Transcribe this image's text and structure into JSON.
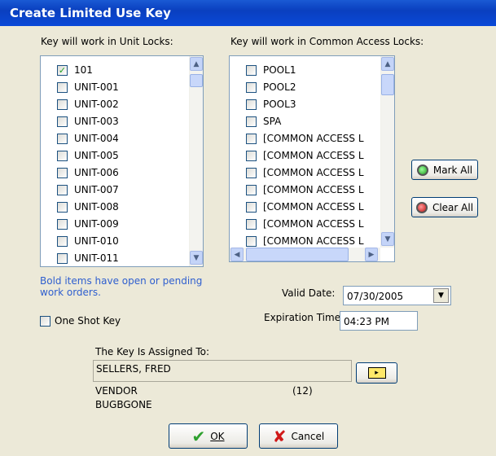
{
  "window": {
    "title": "Create Limited Use Key"
  },
  "unit_locks": {
    "label": "Key will work in Unit Locks:",
    "items": [
      {
        "label": "101",
        "checked": true
      },
      {
        "label": "UNIT-001",
        "checked": false
      },
      {
        "label": "UNIT-002",
        "checked": false
      },
      {
        "label": "UNIT-003",
        "checked": false
      },
      {
        "label": "UNIT-004",
        "checked": false
      },
      {
        "label": "UNIT-005",
        "checked": false
      },
      {
        "label": "UNIT-006",
        "checked": false
      },
      {
        "label": "UNIT-007",
        "checked": false
      },
      {
        "label": "UNIT-008",
        "checked": false
      },
      {
        "label": "UNIT-009",
        "checked": false
      },
      {
        "label": "UNIT-010",
        "checked": false
      },
      {
        "label": "UNIT-011",
        "checked": false
      }
    ]
  },
  "common_locks": {
    "label": "Key will work in Common Access Locks:",
    "items": [
      {
        "label": "POOL1",
        "checked": false
      },
      {
        "label": "POOL2",
        "checked": false
      },
      {
        "label": "POOL3",
        "checked": false
      },
      {
        "label": "SPA",
        "checked": false
      },
      {
        "label": "[COMMON ACCESS L",
        "checked": false
      },
      {
        "label": "[COMMON ACCESS L",
        "checked": false
      },
      {
        "label": "[COMMON ACCESS L",
        "checked": false
      },
      {
        "label": "[COMMON ACCESS L",
        "checked": false
      },
      {
        "label": "[COMMON ACCESS L",
        "checked": false
      },
      {
        "label": "[COMMON ACCESS L",
        "checked": false
      },
      {
        "label": "[COMMON ACCESS L",
        "checked": false
      }
    ]
  },
  "buttons": {
    "mark_all": "Mark All",
    "clear_all": "Clear All",
    "ok": "OK",
    "cancel": "Cancel"
  },
  "note": {
    "line1": "Bold items have open or pending",
    "line2": "work orders."
  },
  "one_shot": {
    "label": "One Shot Key",
    "checked": false
  },
  "valid_date": {
    "label": "Valid Date:",
    "value": "07/30/2005"
  },
  "expiration": {
    "label": "Expiration Time:",
    "value": "04:23 PM"
  },
  "assigned": {
    "label": "The Key Is Assigned To:",
    "name": "SELLERS, FRED",
    "type": "VENDOR",
    "code": "(12)",
    "company": "BUGBGONE"
  },
  "colors": {
    "note_text": "#2f5fcf",
    "title_bg": "#0a49d8"
  }
}
